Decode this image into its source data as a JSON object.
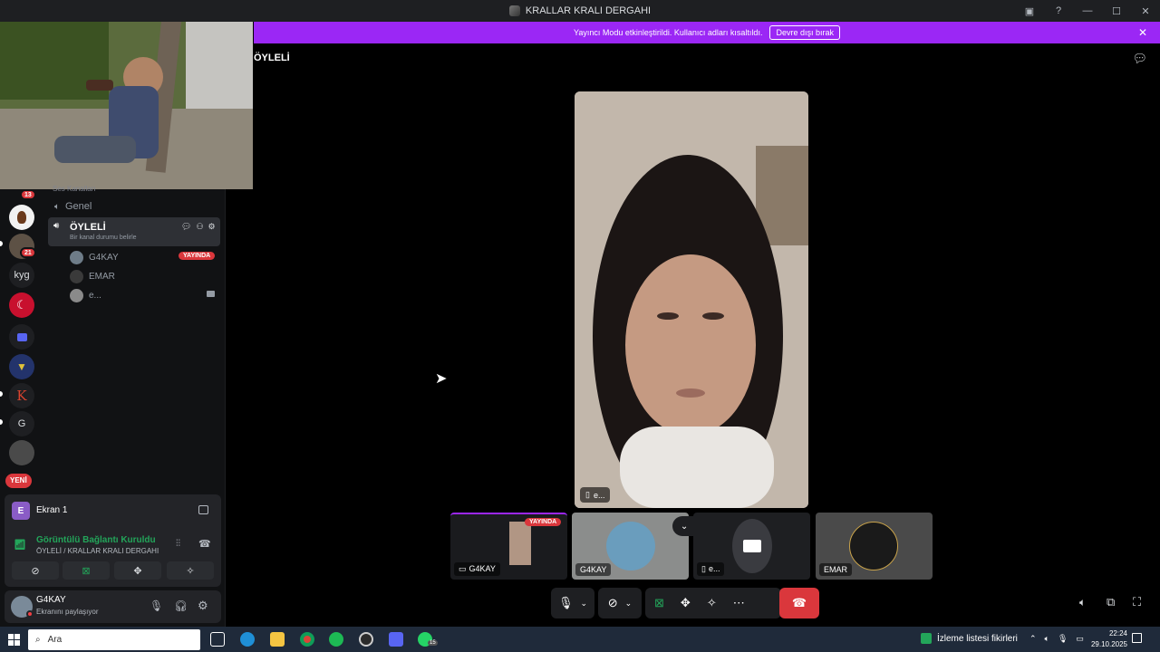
{
  "window": {
    "title": "KRALLAR KRALI DERGAHI",
    "controls": [
      "▣",
      "?",
      "—",
      "☐",
      "✕"
    ]
  },
  "banner": {
    "message": "Yayıncı Modu etkinleştirildi. Kullanıcı adları kısaltıldı.",
    "button": "Devre dışı bırak",
    "close": "✕"
  },
  "rail": {
    "badge_top": "13",
    "badge_mid": "21",
    "kyg": "kyg",
    "k_letter": "K",
    "g_letter": "G",
    "new_label": "YENİ"
  },
  "channels": {
    "category": "Ses Kanalları",
    "genel": "Genel",
    "active": {
      "name": "ÖYLELİ",
      "status_hint": "Bir kanal durumu belirle"
    },
    "users": [
      {
        "name": "G4KAY",
        "live": "YAYINDA"
      },
      {
        "name": "EMAR"
      },
      {
        "name": "e..."
      }
    ]
  },
  "screen_panel": {
    "label": "Ekran 1",
    "avatar_letter": "E"
  },
  "rtc_panel": {
    "status": "Görüntülü Bağlantı Kuruldu",
    "location": "ÖYLELİ / KRALLAR KRALI DERGAHI"
  },
  "user_panel": {
    "name": "G4KAY",
    "status": "Ekranını paylaşıyor"
  },
  "main": {
    "heading": "ÖYLELİ",
    "main_tile_name": "e...",
    "tiles": [
      {
        "name": "G4KAY",
        "live": "YAYINDA"
      },
      {
        "name": "G4KAY"
      },
      {
        "name": "e..."
      },
      {
        "name": "EMAR"
      }
    ]
  },
  "taskbar": {
    "search_placeholder": "Ara",
    "watchlist": "İzleme listesi fikirleri",
    "time": "22:24",
    "date": "29.10.2025",
    "whatsapp_badge": "15"
  }
}
